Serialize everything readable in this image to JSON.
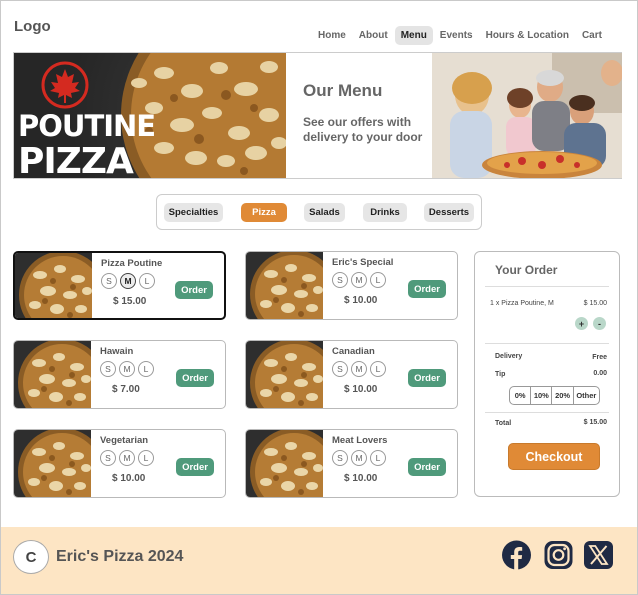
{
  "header": {
    "logo": "Logo",
    "nav": [
      "Home",
      "About",
      "Menu",
      "Events",
      "Hours & Location",
      "Cart"
    ],
    "active_nav": "Menu"
  },
  "hero": {
    "brand_line1": "POUTINE",
    "brand_line2": "PIZZA",
    "title": "Our Menu",
    "subtitle": "See our offers with delivery to your door"
  },
  "categories": {
    "items": [
      "Specialties",
      "Pizza",
      "Salads",
      "Drinks",
      "Desserts"
    ],
    "active": "Pizza"
  },
  "menu": {
    "items": [
      {
        "name": "Pizza Poutine",
        "price": "$ 15.00",
        "sizes": [
          "S",
          "M",
          "L"
        ],
        "selected_size": "M",
        "order_label": "Order"
      },
      {
        "name": "Eric's Special",
        "price": "$ 10.00",
        "sizes": [
          "S",
          "M",
          "L"
        ],
        "selected_size": "",
        "order_label": "Order"
      },
      {
        "name": "Hawain",
        "price": "$ 7.00",
        "sizes": [
          "S",
          "M",
          "L"
        ],
        "selected_size": "",
        "order_label": "Order"
      },
      {
        "name": "Canadian",
        "price": "$ 10.00",
        "sizes": [
          "S",
          "M",
          "L"
        ],
        "selected_size": "",
        "order_label": "Order"
      },
      {
        "name": "Vegetarian",
        "price": "$ 10.00",
        "sizes": [
          "S",
          "M",
          "L"
        ],
        "selected_size": "",
        "order_label": "Order"
      },
      {
        "name": "Meat Lovers",
        "price": "$ 10.00",
        "sizes": [
          "S",
          "M",
          "L"
        ],
        "selected_size": "",
        "order_label": "Order"
      }
    ]
  },
  "order": {
    "title": "Your Order",
    "line_item": "1 x Pizza Poutine, M",
    "line_price": "$ 15.00",
    "plus": "+",
    "minus": "-",
    "delivery_label": "Delivery",
    "delivery_value": "Free",
    "tip_label": "Tip",
    "tip_value": "0.00",
    "tip_options": [
      "0%",
      "10%",
      "20%",
      "Other"
    ],
    "total_label": "Total",
    "total_value": "$ 15.00",
    "checkout_label": "Checkout"
  },
  "footer": {
    "logo_letter": "C",
    "text": "Eric's Pizza 2024",
    "social": [
      "facebook-icon",
      "instagram-icon",
      "x-icon"
    ]
  },
  "colors": {
    "accent_orange": "#e08a36",
    "order_green": "#4f9a7b",
    "footer_bg": "#fde5c4"
  }
}
